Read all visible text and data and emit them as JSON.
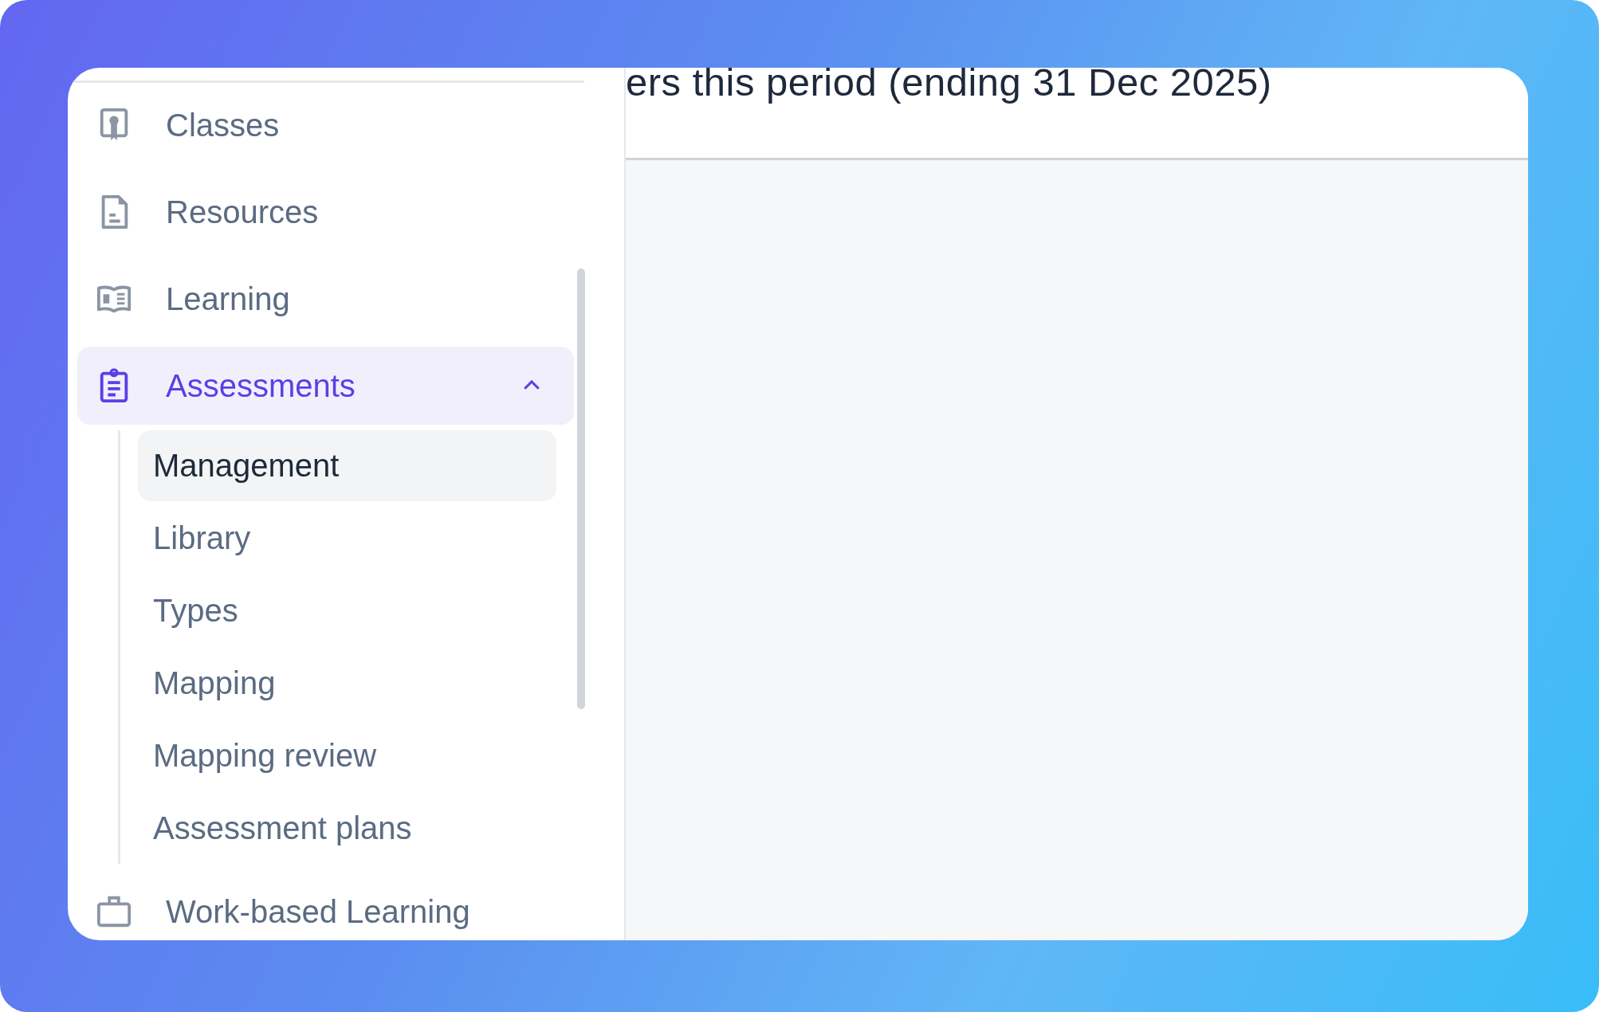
{
  "header": {
    "title": "ers this period (ending 31 Dec 2025)"
  },
  "sidebar": {
    "items": [
      {
        "label": "Classes",
        "selected": false
      },
      {
        "label": "Resources",
        "selected": false
      },
      {
        "label": "Learning",
        "selected": false
      },
      {
        "label": "Assessments",
        "selected": true,
        "expanded": true,
        "children": [
          {
            "label": "Management",
            "selected": true
          },
          {
            "label": "Library",
            "selected": false
          },
          {
            "label": "Types",
            "selected": false
          },
          {
            "label": "Mapping",
            "selected": false
          },
          {
            "label": "Mapping review",
            "selected": false
          },
          {
            "label": "Assessment plans",
            "selected": false
          }
        ]
      },
      {
        "label": "Work-based Learning",
        "selected": false
      }
    ]
  }
}
